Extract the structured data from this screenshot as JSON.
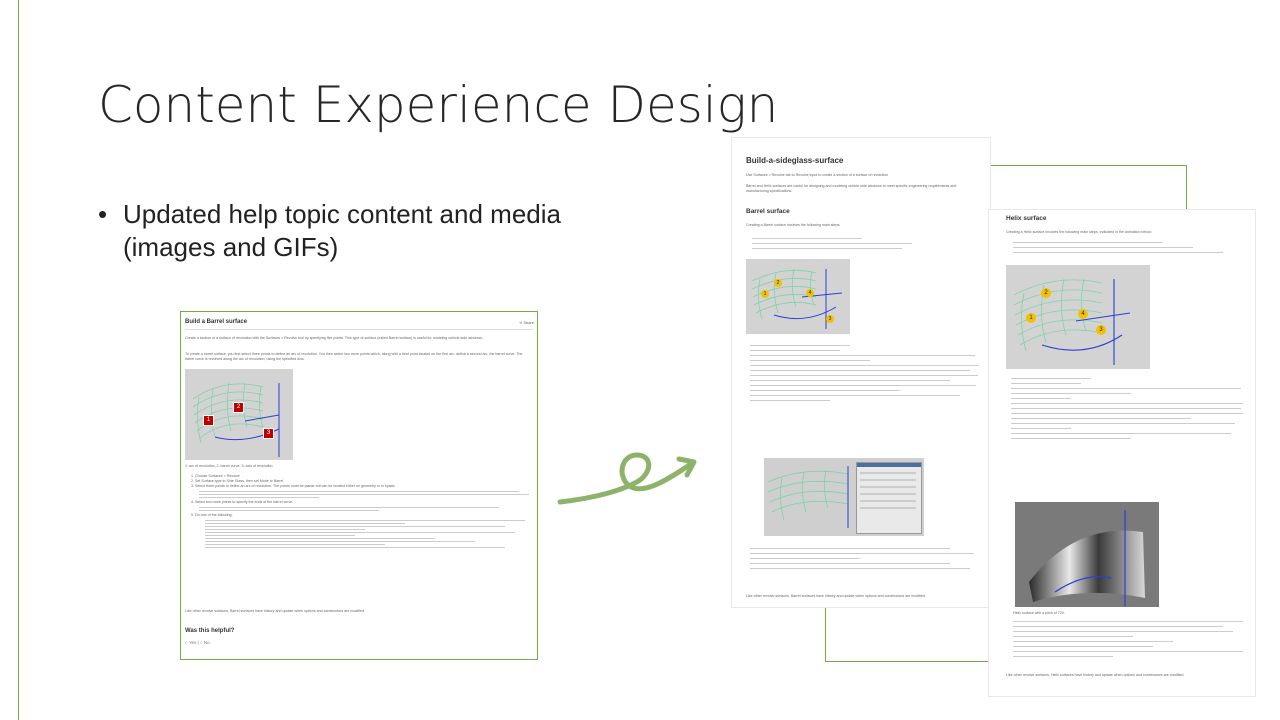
{
  "slide": {
    "title": "Content Experience Design",
    "bullet": "Updated help topic content and media (images and GIFs)"
  },
  "doc_barrel": {
    "title": "Build a Barrel surface",
    "share": "Share",
    "intro": "Create a section of a surface of revolution with the Surfaces > Revolve tool by specifying five points. This type of surface (called Barrel surface) is useful for modeling vehicle side windows.",
    "intro2": "To create a barrel surface, you first select three points to define an arc of revolution. You then select two more points which, along with a third point located on the first arc, define a second arc, the barrel curve. The barrel curve is revolved along the arc of revolution, using the specified axis.",
    "caption": "1: arc of revolution, 2: barrel curve, 3: axis of revolution",
    "steps": [
      "1. Choose Surfaces > Revolve",
      "2. Set Surface type to Side Glass, then set Mode to Barrel.",
      "3. Select three points to define an arc of revolution. The points must be planar but can be located either on geometry or in space.",
      "4. Select two more points to specify the ends of the barrel curve.",
      "5. Do one of the following:"
    ],
    "outro": "Like other revolve surfaces, Barrel surfaces have history and update when options and constructors are modified.",
    "helpful": "Was this helpful?",
    "yes": "Yes",
    "no": "No",
    "markers": [
      "1",
      "2",
      "3"
    ]
  },
  "doc_sideglass": {
    "title": "Build-a-sideglass-surface",
    "intro": "Use Surfaces > Revolve tab to Revolve input to create a section of a surface of revolution",
    "intro2": "Barrel and Helix surfaces are useful for designing and modeling vehicle side windows to meet specific engineering requirements and manufacturing specifications.",
    "section": "Barrel surface",
    "section_intro": "Creating a Barrel surface involves the following main steps:",
    "outro": "Like other revolve surfaces, Barrel surfaces have history and update when options and constructors are modified.",
    "markers": [
      "2",
      "1",
      "4",
      "3"
    ]
  },
  "doc_helix": {
    "title": "Helix surface",
    "intro": "Creating a Helix surface involves the following main steps, indicated in the animation below:",
    "caption": "Helix surface with a pitch of 720.",
    "outro": "Like other revolve surfaces, Helix surfaces have history and update when options and constructors are modified.",
    "markers": [
      "2",
      "1",
      "4",
      "3"
    ]
  },
  "colors": {
    "accent": "#70ad47",
    "arrow": "#8db36b",
    "curve": "#7fd3a8",
    "axis": "#2b3fd6",
    "marker_red": "#c00000",
    "marker_yellow": "#f2c200"
  }
}
